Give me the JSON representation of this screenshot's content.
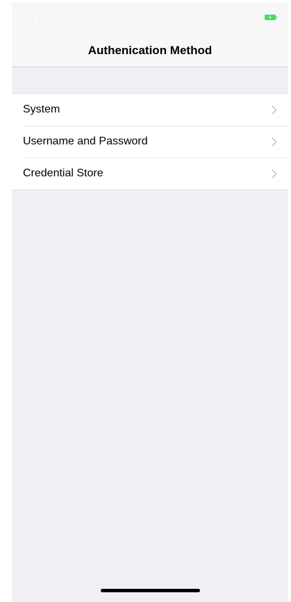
{
  "status_bar": {
    "time": "1:13",
    "icons": [
      "wifi-icon",
      "battery-icon"
    ],
    "battery_color": "#4cd964"
  },
  "nav": {
    "title": "Authenication Method"
  },
  "list": {
    "items": [
      {
        "label": "System",
        "icon": "chevron-right-icon"
      },
      {
        "label": "Username and Password",
        "icon": "chevron-right-icon"
      },
      {
        "label": "Credential Store",
        "icon": "chevron-right-icon"
      }
    ]
  },
  "colors": {
    "background": "#efeff4",
    "bar_background": "#f7f7f7",
    "separator": "#e5e5ea",
    "chevron": "#c7c7cc"
  }
}
